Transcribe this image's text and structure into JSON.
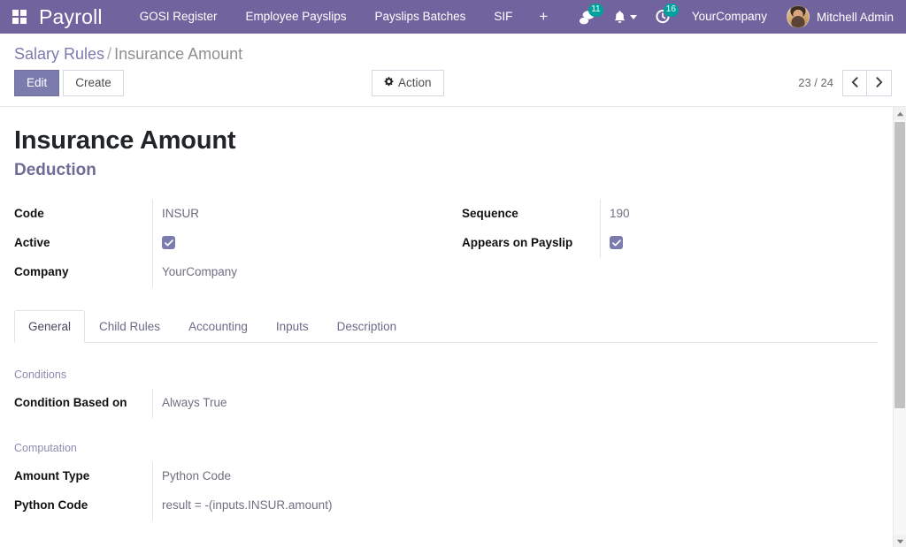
{
  "navbar": {
    "apps_icon": "apps-grid-icon",
    "brand": "Payroll",
    "menu_items": [
      {
        "label": "GOSI Register"
      },
      {
        "label": "Employee Payslips"
      },
      {
        "label": "Payslips Batches"
      },
      {
        "label": "SIF"
      }
    ],
    "plus_label": "+",
    "messages": {
      "icon": "messages-icon",
      "count": "11"
    },
    "activities": {
      "icon": "bell-icon"
    },
    "todo": {
      "icon": "clock-icon",
      "count": "16"
    },
    "company": "YourCompany",
    "user": "Mitchell Admin",
    "background_color": "#71639e",
    "badge_color": "#00a09d"
  },
  "control_panel": {
    "breadcrumb": {
      "parent": "Salary Rules",
      "separator": "/",
      "current": "Insurance Amount"
    },
    "edit_label": "Edit",
    "create_label": "Create",
    "action_label": "Action",
    "action_icon": "gear-icon",
    "pager": {
      "count": "23 / 24",
      "prev_icon": "chevron-left-icon",
      "next_icon": "chevron-right-icon"
    },
    "primary_color": "#7c7bad"
  },
  "form": {
    "title": "Insurance Amount",
    "subtitle": "Deduction",
    "left_fields": [
      {
        "label": "Code",
        "value": "INSUR",
        "type": "text"
      },
      {
        "label": "Active",
        "value": "",
        "type": "checkbox",
        "checked": true
      },
      {
        "label": "Company",
        "value": "YourCompany",
        "type": "text"
      }
    ],
    "right_fields": [
      {
        "label": "Sequence",
        "value": "190",
        "type": "text"
      },
      {
        "label": "Appears on Payslip",
        "value": "",
        "type": "checkbox",
        "checked": true
      }
    ]
  },
  "notebook": {
    "tabs": [
      {
        "label": "General",
        "active": true
      },
      {
        "label": "Child Rules",
        "active": false
      },
      {
        "label": "Accounting",
        "active": false
      },
      {
        "label": "Inputs",
        "active": false
      },
      {
        "label": "Description",
        "active": false
      }
    ],
    "general": {
      "groups": [
        {
          "title": "Conditions",
          "fields": [
            {
              "label": "Condition Based on",
              "value": "Always True"
            }
          ]
        },
        {
          "title": "Computation",
          "fields": [
            {
              "label": "Amount Type",
              "value": "Python Code"
            },
            {
              "label": "Python Code",
              "value": "result = -(inputs.INSUR.amount)"
            }
          ]
        }
      ]
    }
  },
  "scrollbar": {
    "up_icon": "caret-up-icon",
    "down_icon": "caret-down-icon"
  }
}
